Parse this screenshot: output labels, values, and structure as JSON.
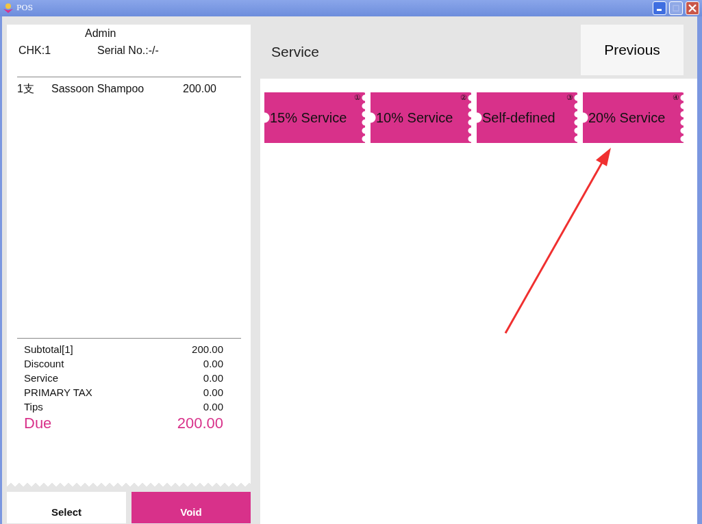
{
  "window": {
    "title": "POS",
    "maximize_disabled": true
  },
  "receipt": {
    "operator": "Admin",
    "check": "CHK:1",
    "serial": "Serial No.:-/-",
    "items": [
      {
        "qty": "1支",
        "name": "Sassoon Shampoo",
        "price": "200.00"
      }
    ],
    "totals": [
      {
        "label": "Subtotal[1]",
        "value": "200.00",
        "kind": "normal"
      },
      {
        "label": "Discount",
        "value": "0.00",
        "kind": "normal"
      },
      {
        "label": "Service",
        "value": "0.00",
        "kind": "normal"
      },
      {
        "label": "PRIMARY TAX",
        "value": "0.00",
        "kind": "normal"
      },
      {
        "label": "Tips",
        "value": "0.00",
        "kind": "normal"
      },
      {
        "label": "Due",
        "value": "200.00",
        "kind": "due"
      }
    ]
  },
  "bottom_buttons": [
    {
      "label": "Select",
      "kind": "plain"
    },
    {
      "label": "Void",
      "kind": "accent"
    }
  ],
  "header": {
    "title": "Service",
    "previous": "Previous"
  },
  "service_buttons": [
    {
      "label": "15% Service",
      "number": "①"
    },
    {
      "label": "10% Service",
      "number": "②"
    },
    {
      "label": "Self-defined",
      "number": "③"
    },
    {
      "label": "20% Service",
      "number": "④"
    }
  ]
}
